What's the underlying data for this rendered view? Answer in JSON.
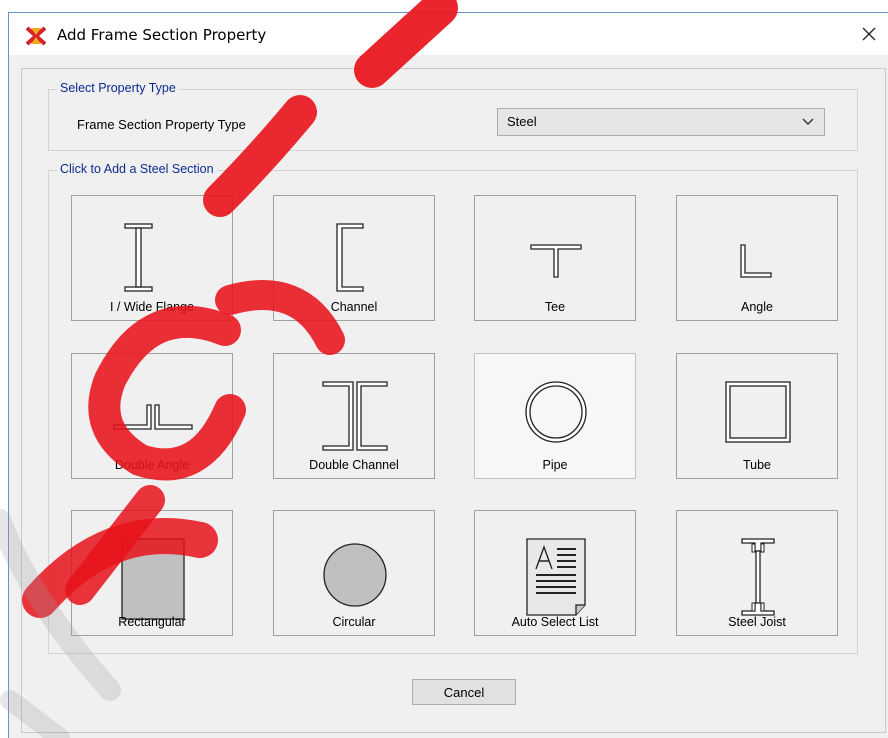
{
  "window": {
    "title": "Add Frame Section Property"
  },
  "property_type_group": {
    "title": "Select Property Type",
    "label": "Frame Section Property Type",
    "selected_value": "Steel"
  },
  "section_group": {
    "title": "Click to Add a Steel Section",
    "sections": [
      {
        "label": "I / Wide Flange",
        "icon": "i-wide-flange-icon"
      },
      {
        "label": "Channel",
        "icon": "channel-icon"
      },
      {
        "label": "Tee",
        "icon": "tee-icon"
      },
      {
        "label": "Angle",
        "icon": "angle-icon"
      },
      {
        "label": "Double Angle",
        "icon": "double-angle-icon"
      },
      {
        "label": "Double Channel",
        "icon": "double-channel-icon"
      },
      {
        "label": "Pipe",
        "icon": "pipe-icon"
      },
      {
        "label": "Tube",
        "icon": "tube-icon"
      },
      {
        "label": "Rectangular",
        "icon": "rectangular-icon"
      },
      {
        "label": "Circular",
        "icon": "circular-icon"
      },
      {
        "label": "Auto Select List",
        "icon": "auto-select-list-icon"
      },
      {
        "label": "Steel Joist",
        "icon": "steel-joist-icon"
      }
    ]
  },
  "footer": {
    "cancel_label": "Cancel"
  },
  "colors": {
    "group_title": "#0c2a8f",
    "watermark": "#e8121b",
    "dialog_bg": "#f0f0f0"
  }
}
